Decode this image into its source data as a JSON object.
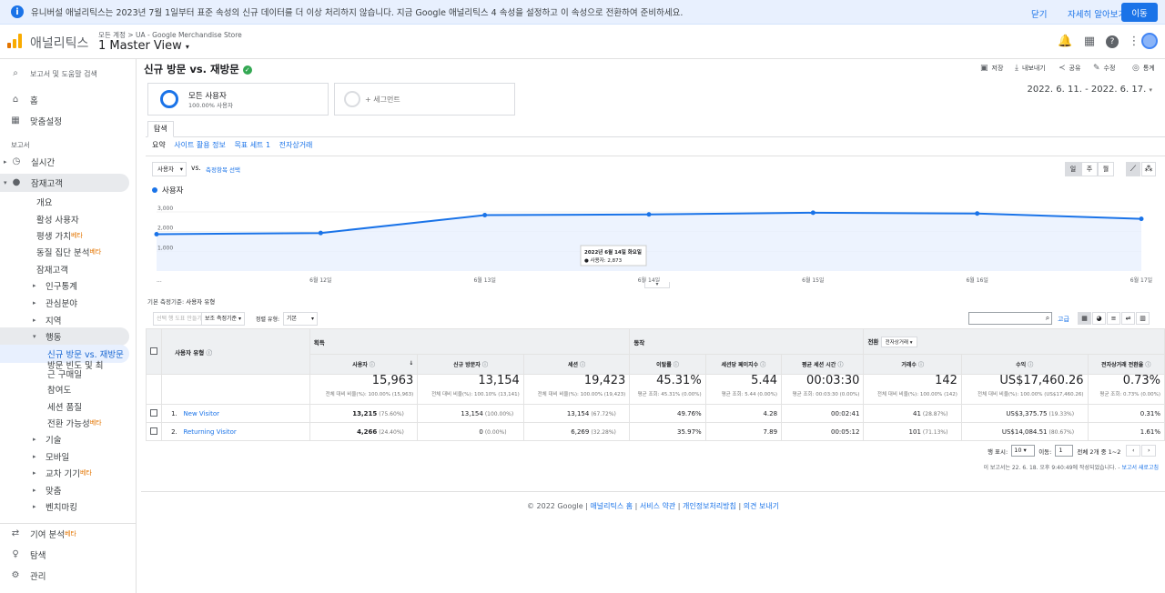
{
  "banner": {
    "message": "유니버설 애널리틱스는 2023년 7월 1일부터 표준 속성의 신규 데이터를 더 이상 처리하지 않습니다. 지금 Google 애널리틱스 4 속성을 설정하고 이 속성으로 전환하여 준비하세요.",
    "dismiss": "닫기",
    "learn_more": "자세히 알아보기",
    "go": "이동"
  },
  "header": {
    "app_name": "애널리틱스",
    "breadcrumb": "모든 계정 > UA - Google Merchandise Store",
    "view": "1 Master View",
    "icons": [
      "bell-icon",
      "apps-icon",
      "help-icon",
      "more-vert-icon",
      "account-icon"
    ]
  },
  "sidebar": {
    "search": "보고서 및 도움말 검색",
    "home": "홈",
    "custom": "맞춤설정",
    "reports_label": "보고서",
    "realtime": "실시간",
    "audience": "잠재고객",
    "audience_items": [
      "개요",
      "활성 사용자",
      "평생 가치",
      "동질 집단 분석",
      "잠재고객"
    ],
    "beta": "베타",
    "demographics": "인구통계",
    "interests": "관심분야",
    "geo": "지역",
    "behavior": "행동",
    "behavior_items": [
      "신규 방문 vs. 재방문",
      "방문 빈도 및 최근 구매일",
      "참여도",
      "세션 품질",
      "전환 가능성"
    ],
    "technology": "기술",
    "mobile": "모바일",
    "crossdevice": "교차 기기",
    "custom2": "맞춤",
    "benchmark": "벤치마킹",
    "attribution": "기여 분석",
    "discover": "탐색",
    "admin": "관리"
  },
  "page": {
    "title": "신규 방문 vs. 재방문",
    "actions": [
      "저장",
      "내보내기",
      "공유",
      "수정",
      "통계"
    ],
    "segment1_name": "모든 사용자",
    "segment1_pct": "100.00% 사용자",
    "segment2": "+ 세그먼트",
    "date_range": "2022. 6. 11. - 2022. 6. 17.",
    "tab": "탐색",
    "subtabs": [
      "요약",
      "사이트 활용 정보",
      "목표 세트 1",
      "전자상거래"
    ],
    "metric_select": "사용자",
    "vs": "vs.",
    "select_metric": "측정항목 선택",
    "granularity": [
      "일",
      "주",
      "월"
    ],
    "legend": "사용자",
    "tooltip_date": "2022년 6월 14일 화요일",
    "tooltip_value": "● 사용자: 2,873",
    "primary_dim_label": "기본 측정기준:",
    "primary_dim_value": "사용자 유형",
    "secondary_dim": "보조 측정기준",
    "plot_rows": "선택 행 도표 만들기",
    "sort_label": "정렬 유형:",
    "sort_value": "기본",
    "advanced": "고급",
    "rows_label": "행 표시:",
    "rows_value": "10",
    "goto_label": "이동:",
    "goto_value": "1",
    "range_text": "전체 2개 중 1~2",
    "report_note": "이 보고서는 22. 6. 18. 오후 9:40:49에 작성되었습니다. - ",
    "refresh": "보고서 새로고침"
  },
  "chart_data": {
    "type": "line",
    "x": [
      "6월 11일",
      "6월 12일",
      "6월 13일",
      "6월 14일",
      "6월 15일",
      "6월 16일",
      "6월 17일"
    ],
    "x_ticks": [
      "...",
      "6월 12일",
      "6월 13일",
      "6월 14일",
      "6월 15일",
      "6월 16일",
      "6월 17일"
    ],
    "series": [
      {
        "name": "사용자",
        "values": [
          1870,
          1930,
          2840,
          2873,
          2960,
          2920,
          2650
        ]
      }
    ],
    "y_ticks": [
      "1,000",
      "2,000",
      "3,000"
    ],
    "ylim": [
      0,
      3600
    ],
    "color": "#1a73e8"
  },
  "table": {
    "col_user_type": "사용자 유형",
    "group_acq": "획득",
    "group_beh": "동작",
    "group_conv": "전환",
    "conv_select": "전자상거래",
    "columns": [
      "사용자",
      "신규 방문자",
      "세션",
      "이탈률",
      "세션당 페이지수",
      "평균 세션 시간",
      "거래수",
      "수익",
      "전자상거래 전환율"
    ],
    "totals": [
      {
        "value": "15,963",
        "sub": "전체 대비 비율(%): 100.00% (15,963)"
      },
      {
        "value": "13,154",
        "sub": "전체 대비 비율(%): 100.10% (13,141)"
      },
      {
        "value": "19,423",
        "sub": "전체 대비 비율(%): 100.00% (19,423)"
      },
      {
        "value": "45.31%",
        "sub": "평균 조회: 45.31% (0.00%)"
      },
      {
        "value": "5.44",
        "sub": "평균 조회: 5.44 (0.00%)"
      },
      {
        "value": "00:03:30",
        "sub": "평균 조회: 00:03:30 (0.00%)"
      },
      {
        "value": "142",
        "sub": "전체 대비 비율(%): 100.00% (142)"
      },
      {
        "value": "US$17,460.26",
        "sub": "전체 대비 비율(%): 100.00% (US$17,460.26)"
      },
      {
        "value": "0.73%",
        "sub": "평균 조회: 0.73% (0.00%)"
      }
    ],
    "rows": [
      {
        "idx": "1.",
        "name": "New Visitor",
        "users": "13,215",
        "users_pct": "(75.60%)",
        "newu": "13,154",
        "newu_pct": "(100.00%)",
        "sessions": "13,154",
        "sess_pct": "(67.72%)",
        "bounce": "49.76%",
        "pps": "4.28",
        "dur": "00:02:41",
        "tx": "41",
        "tx_pct": "(28.87%)",
        "rev": "US$3,375.75",
        "rev_pct": "(19.33%)",
        "conv": "0.31%"
      },
      {
        "idx": "2.",
        "name": "Returning Visitor",
        "users": "4,266",
        "users_pct": "(24.40%)",
        "newu": "0",
        "newu_pct": "(0.00%)",
        "sessions": "6,269",
        "sess_pct": "(32.28%)",
        "bounce": "35.97%",
        "pps": "7.89",
        "dur": "00:05:12",
        "tx": "101",
        "tx_pct": "(71.13%)",
        "rev": "US$14,084.51",
        "rev_pct": "(80.67%)",
        "conv": "1.61%"
      }
    ]
  },
  "footer": {
    "copyright": "© 2022 Google",
    "links": [
      "애널리틱스 홈",
      "서비스 약관",
      "개인정보처리방침",
      "의견 보내기"
    ]
  }
}
